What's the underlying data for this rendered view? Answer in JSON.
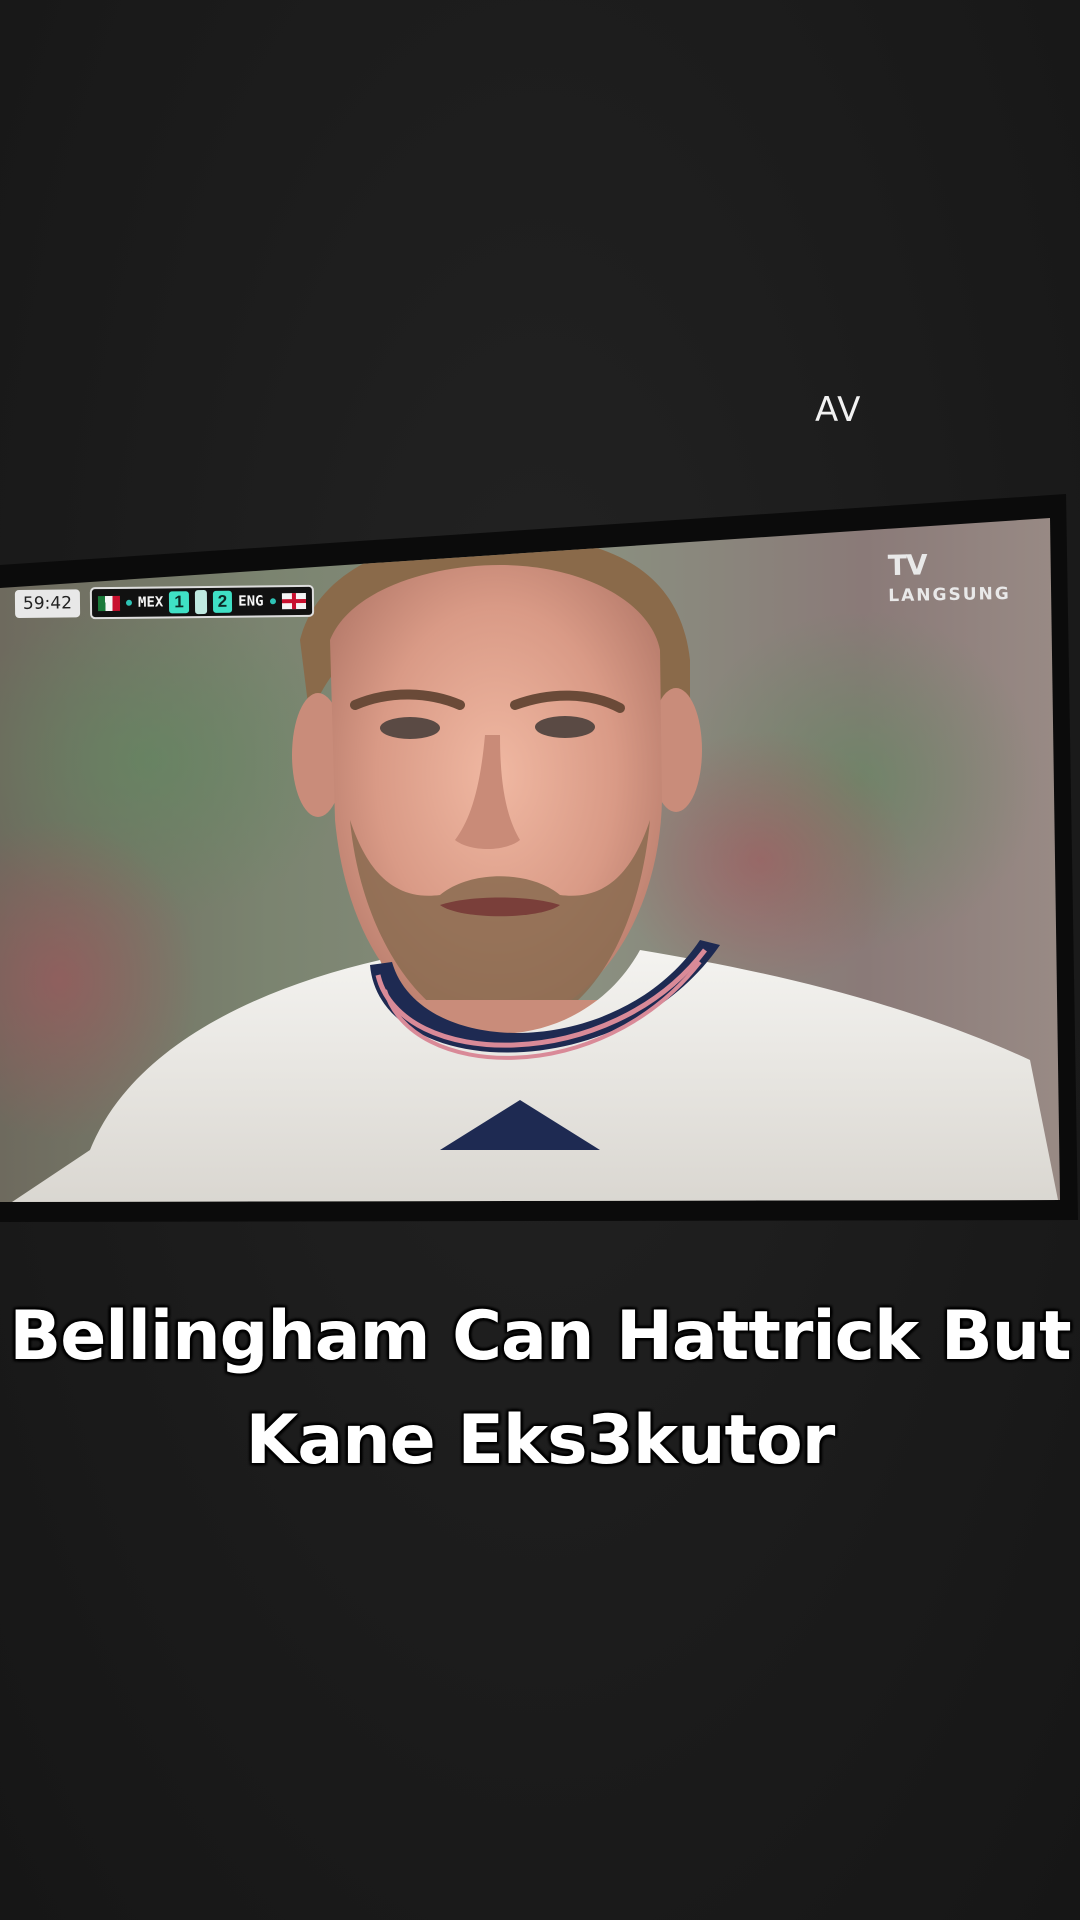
{
  "watermark": {
    "text": "AV"
  },
  "broadcast": {
    "clock": "59:42",
    "home_team": "MEX",
    "home_score": "1",
    "away_score": "2",
    "away_team": "ENG",
    "channel_logo": "TV",
    "channel_status": "LANGSUNG",
    "flag_icons": [
      "mexico-flag-icon",
      "england-flag-icon"
    ]
  },
  "caption": {
    "line1": "Bellingham Can Hattrick But",
    "line2": "Kane Eks3kutor"
  },
  "colors": {
    "background": "#1c1c1c",
    "caption_text": "#ffffff",
    "score_accent": "#3fe0c5"
  }
}
